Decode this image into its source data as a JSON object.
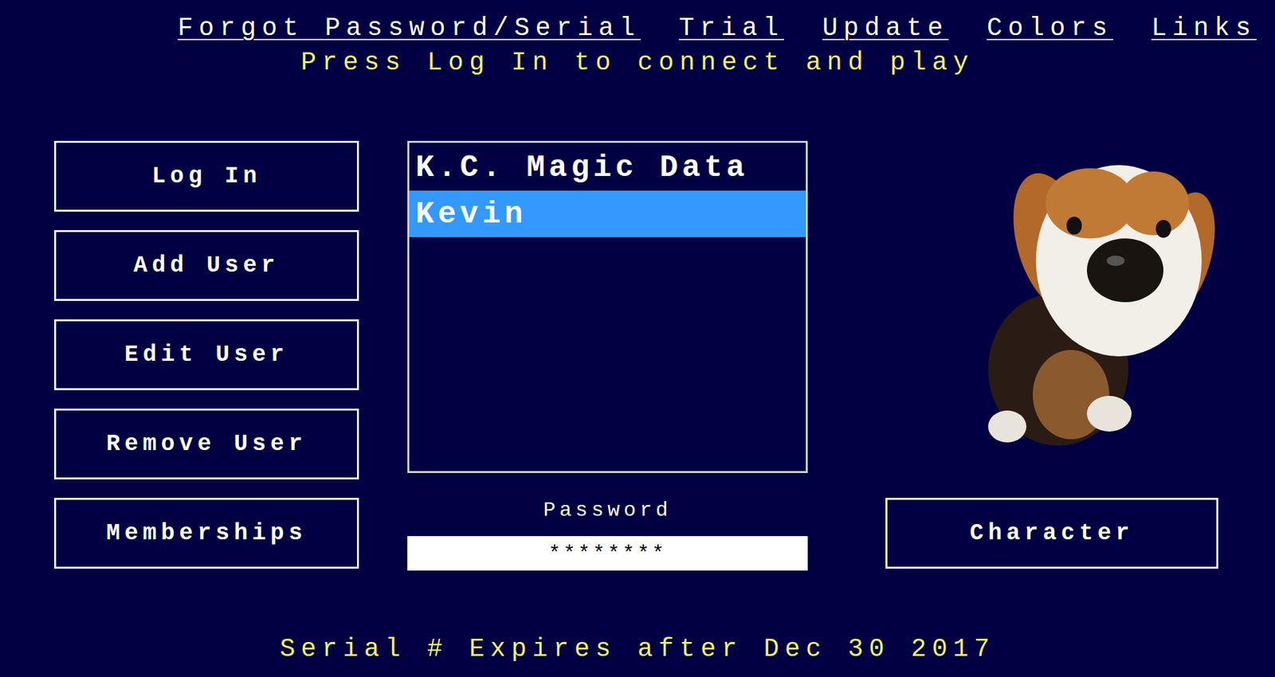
{
  "top_links": [
    "Forgot Password/Serial",
    "Trial",
    "Update",
    "Colors",
    "Links"
  ],
  "status_message": "Press Log In to connect and play",
  "buttons": [
    "Log In",
    "Add User",
    "Edit User",
    "Remove User",
    "Memberships"
  ],
  "users": [
    {
      "name": "K.C. Magic Data",
      "selected": false
    },
    {
      "name": "Kevin",
      "selected": true
    }
  ],
  "password": {
    "label": "Password",
    "value": "********"
  },
  "character_button": "Character",
  "footer": "Serial # Expires after Dec 30 2017"
}
